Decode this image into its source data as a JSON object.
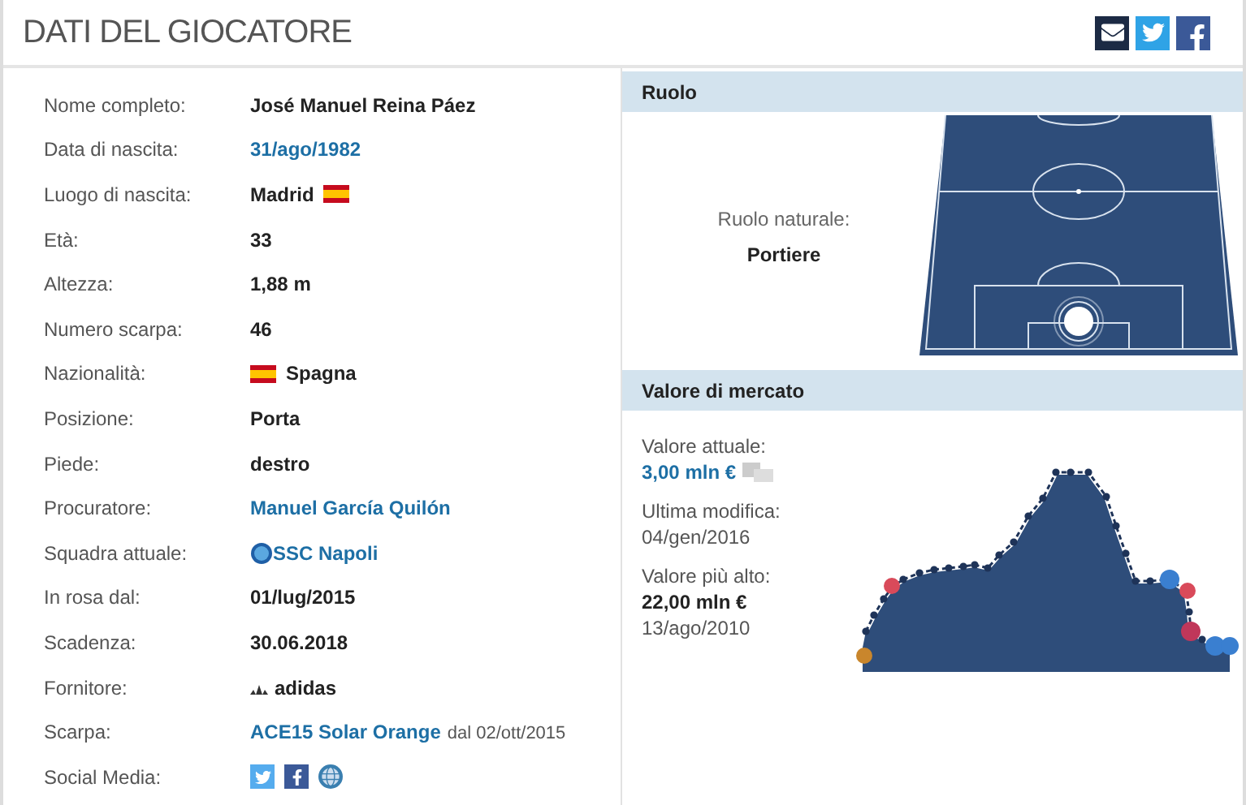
{
  "header": {
    "title": "DATI DEL GIOCATORE"
  },
  "details": [
    {
      "label": "Nome completo:",
      "kind": "text",
      "value": "José Manuel Reina Páez"
    },
    {
      "label": "Data di nascita:",
      "kind": "link",
      "value": "31/ago/1982"
    },
    {
      "label": "Luogo di nascita:",
      "kind": "flag_after",
      "value": "Madrid"
    },
    {
      "label": "Età:",
      "kind": "text",
      "value": "33"
    },
    {
      "label": "Altezza:",
      "kind": "text",
      "value": "1,88 m"
    },
    {
      "label": "Numero scarpa:",
      "kind": "text",
      "value": "46"
    },
    {
      "label": "Nazionalità:",
      "kind": "flag_before",
      "value": "Spagna"
    },
    {
      "label": "Posizione:",
      "kind": "text",
      "value": "Porta"
    },
    {
      "label": "Piede:",
      "kind": "text",
      "value": "destro"
    },
    {
      "label": "Procuratore:",
      "kind": "link",
      "value": "Manuel García Quilón"
    },
    {
      "label": "Squadra attuale:",
      "kind": "club",
      "value": "SSC Napoli"
    },
    {
      "label": "In rosa dal:",
      "kind": "text",
      "value": "01/lug/2015"
    },
    {
      "label": "Scadenza:",
      "kind": "text",
      "value": "30.06.2018"
    },
    {
      "label": "Fornitore:",
      "kind": "brand",
      "value": "adidas"
    },
    {
      "label": "Scarpa:",
      "kind": "shoe",
      "value": "ACE15 Solar Orange",
      "suffix": "dal 02/ott/2015"
    },
    {
      "label": "Social Media:",
      "kind": "social"
    }
  ],
  "role": {
    "title": "Ruolo",
    "label": "Ruolo naturale:",
    "value": "Portiere"
  },
  "market": {
    "title": "Valore di mercato",
    "current_label": "Valore attuale:",
    "current_value": "3,00 mln €",
    "modified_label": "Ultima modifica:",
    "modified_value": "04/gen/2016",
    "highest_label": "Valore più alto:",
    "highest_value": "22,00 mln €",
    "highest_date": "13/ago/2010"
  }
}
